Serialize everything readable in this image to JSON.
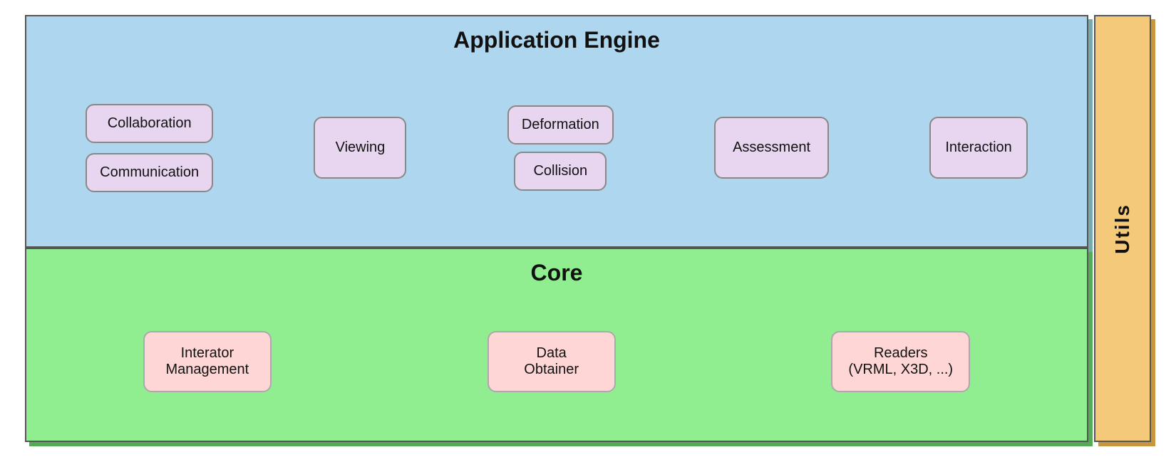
{
  "appEngine": {
    "title": "Application Engine",
    "modules": {
      "collaboration": "Collaboration",
      "communication": "Communication",
      "viewing": "Viewing",
      "deformation": "Deformation",
      "collision": "Collision",
      "assessment": "Assessment",
      "interaction": "Interaction"
    }
  },
  "core": {
    "title": "Core",
    "modules": {
      "interatorManagement": "Interator\nManagement",
      "dataObtainer": "Data\nObtainer",
      "readers": "Readers\n(VRML, X3D, ...)"
    }
  },
  "utils": {
    "label": "Utils"
  }
}
